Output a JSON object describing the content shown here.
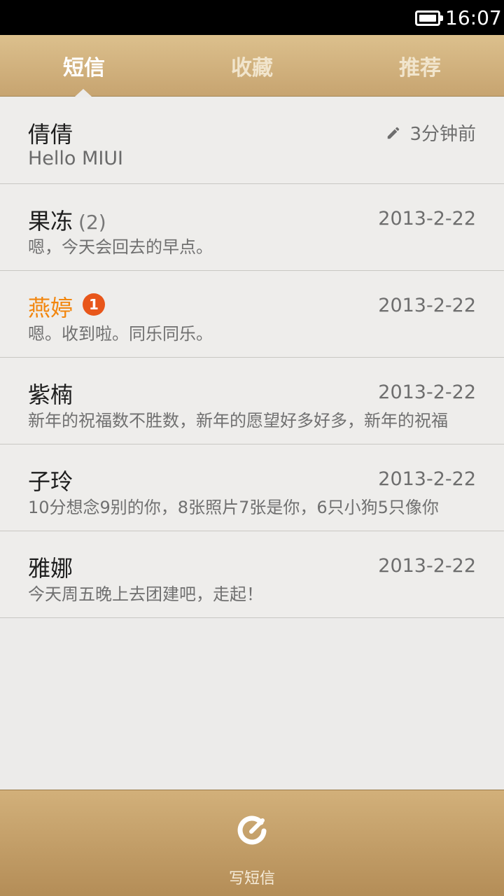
{
  "status_bar": {
    "time": "16:07"
  },
  "tabs": [
    {
      "label": "短信",
      "active": true
    },
    {
      "label": "收藏",
      "active": false
    },
    {
      "label": "推荐",
      "active": false
    }
  ],
  "conversations": [
    {
      "name": "倩倩",
      "draft_time": "3分钟前",
      "preview": "Hello MIUI"
    },
    {
      "name": "果冻",
      "count": "(2)",
      "date": "2013-2-22",
      "preview": "嗯，今天会回去的早点。"
    },
    {
      "name": "燕婷",
      "unread_badge": "1",
      "date": "2013-2-22",
      "preview": "嗯。收到啦。同乐同乐。"
    },
    {
      "name": "紫楠",
      "date": "2013-2-22",
      "preview": "新年的祝福数不胜数，新年的愿望好多好多，新年的祝福"
    },
    {
      "name": "子玲",
      "date": "2013-2-22",
      "preview": "10分想念9别的你，8张照片7张是你，6只小狗5只像你"
    },
    {
      "name": "雅娜",
      "date": "2013-2-22",
      "preview": "今天周五晚上去团建吧，走起！"
    }
  ],
  "bottom_bar": {
    "compose_label": "写短信"
  },
  "colors": {
    "header": "#d3b17c",
    "unread_name": "#f2860e",
    "badge": "#e8561a",
    "background": "#ecebea"
  }
}
